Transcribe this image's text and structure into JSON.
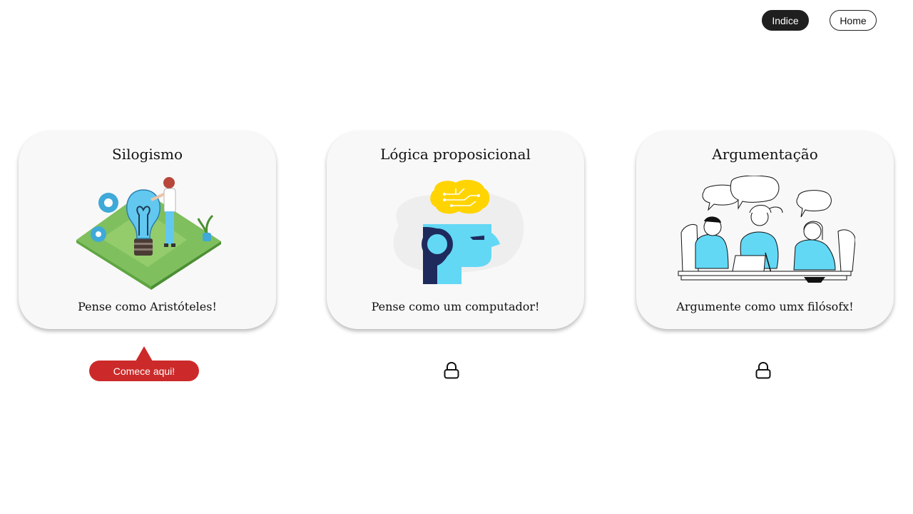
{
  "nav": {
    "indice_label": "Indice",
    "home_label": "Home"
  },
  "cards": [
    {
      "title": "Silogismo",
      "subtitle": "Pense como Aristóteles!",
      "icon": "lightbulb-illustration",
      "locked": false
    },
    {
      "title": "Lógica proposicional",
      "subtitle": "Pense como um computador!",
      "icon": "ai-head-illustration",
      "locked": true
    },
    {
      "title": "Argumentação",
      "subtitle": "Argumente como umx filósofx!",
      "icon": "discussion-illustration",
      "locked": true
    }
  ],
  "start": {
    "label": "Comece aqui!"
  },
  "colors": {
    "accent_red": "#cc2a2a",
    "dark_button": "#1f1f1f",
    "card_bg": "#f8f8f8",
    "illustration_blue": "#62d8f5"
  }
}
